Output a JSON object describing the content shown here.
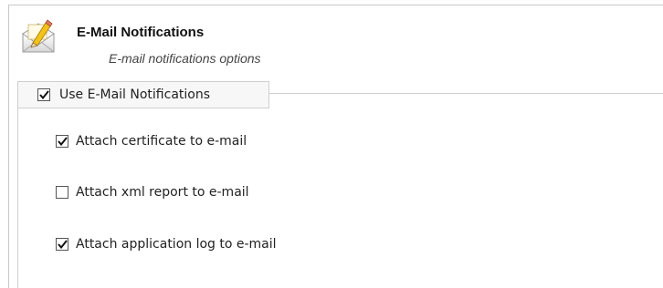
{
  "header": {
    "title": "E-Mail Notifications",
    "subtitle": "E-mail notifications options",
    "icon": "envelope-pencil-icon"
  },
  "group": {
    "label": "Use E-Mail Notifications",
    "checked": true
  },
  "options": [
    {
      "label": "Attach certificate to e-mail",
      "checked": true
    },
    {
      "label": "Attach xml report to e-mail",
      "checked": false
    },
    {
      "label": "Attach application log to e-mail",
      "checked": true
    }
  ],
  "colors": {
    "border": "#c9c9c9",
    "legend_bg": "#f7f7f7",
    "checkmark": "#111111"
  }
}
